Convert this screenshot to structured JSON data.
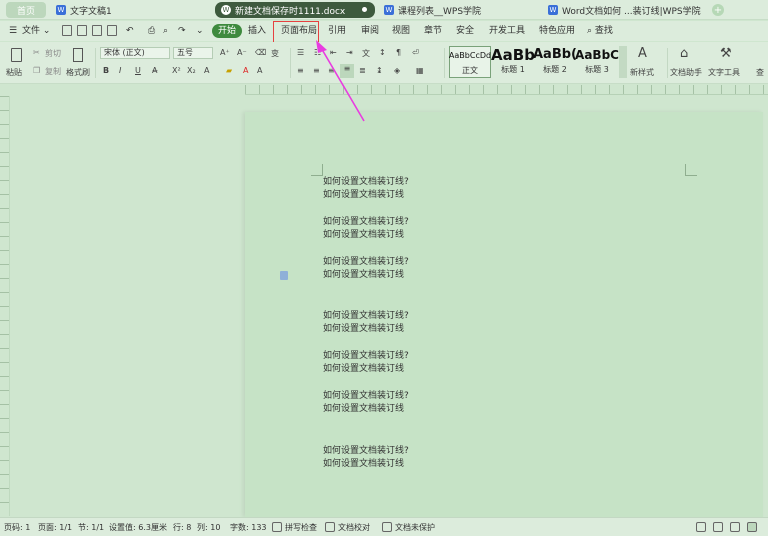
{
  "tabs": {
    "home": "首页",
    "doc1": "文字文稿1",
    "active": "新建文档保存时1111.docx",
    "course": "课程列表__WPS学院",
    "word": "Word文档如何 ...装订线|WPS学院"
  },
  "menu": {
    "file": "文件",
    "items": [
      "开始",
      "插入",
      "页面布局",
      "引用",
      "审阅",
      "视图",
      "章节",
      "安全",
      "开发工具",
      "特色应用",
      "查找"
    ]
  },
  "ribbon": {
    "paste": "粘贴",
    "cut": "剪切",
    "copy": "复制",
    "format_painter": "格式刷",
    "font_name": "宋体 (正文)",
    "font_size": "五号",
    "bold": "B",
    "italic": "I",
    "underline": "U",
    "styles": [
      {
        "preview": "AaBbCcDd",
        "label": "正文"
      },
      {
        "preview": "AaBb",
        "label": "标题 1"
      },
      {
        "preview": "AaBb(",
        "label": "标题 2"
      },
      {
        "preview": "AaBbC",
        "label": "标题 3"
      }
    ],
    "new_style": "新样式",
    "doc_assistant": "文档助手",
    "text_tools": "文字工具",
    "find_short": "查"
  },
  "document": {
    "paragraphs": [
      [
        "如何设置文档装订线?",
        "如何设置文档装订线"
      ],
      [
        "如何设置文档装订线?",
        "如何设置文档装订线"
      ],
      [
        "如何设置文档装订线?",
        "如何设置文档装订线"
      ],
      [
        "如何设置文档装订线?",
        "如何设置文档装订线"
      ],
      [
        "如何设置文档装订线?",
        "如何设置文档装订线"
      ],
      [
        "如何设置文档装订线?",
        "如何设置文档装订线"
      ],
      [
        "如何设置文档装订线?",
        "如何设置文档装订线"
      ]
    ]
  },
  "status": {
    "page_num": "页码: 1",
    "page": "页面: 1/1",
    "section": "节: 1/1",
    "setting": "设置值: 6.3厘米",
    "row": "行: 8",
    "col": "列: 10",
    "words": "字数: 133",
    "spell": "拼写检查",
    "proof": "文档校对",
    "protect": "文档未保护"
  },
  "colors": {
    "highlight": "#e64040",
    "arrow": "#e83ce0",
    "active_tab": "#3e5a3e",
    "page_bg": "#c6e3c6"
  }
}
